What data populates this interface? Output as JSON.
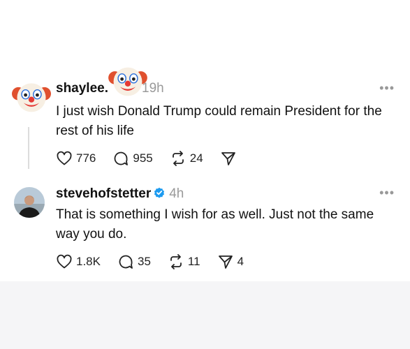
{
  "posts": [
    {
      "username": "shaylee.",
      "time": "19h",
      "avatar_icon": "clown-face-icon",
      "text": "I just wish Donald Trump could remain President for the rest of his life",
      "likes": "776",
      "replies": "955",
      "reposts": "24",
      "shares": ""
    },
    {
      "username": "stevehofstetter",
      "verified": true,
      "time": "4h",
      "avatar_icon": "profile-photo",
      "text": "That is something I wish for as well. Just not the same way you do.",
      "likes": "1.8K",
      "replies": "35",
      "reposts": "11",
      "shares": "4"
    }
  ],
  "more_label": "•••",
  "colors": {
    "accent": "#1d9bf0",
    "muted": "#9a9a9a",
    "clown_red": "#e53935"
  }
}
